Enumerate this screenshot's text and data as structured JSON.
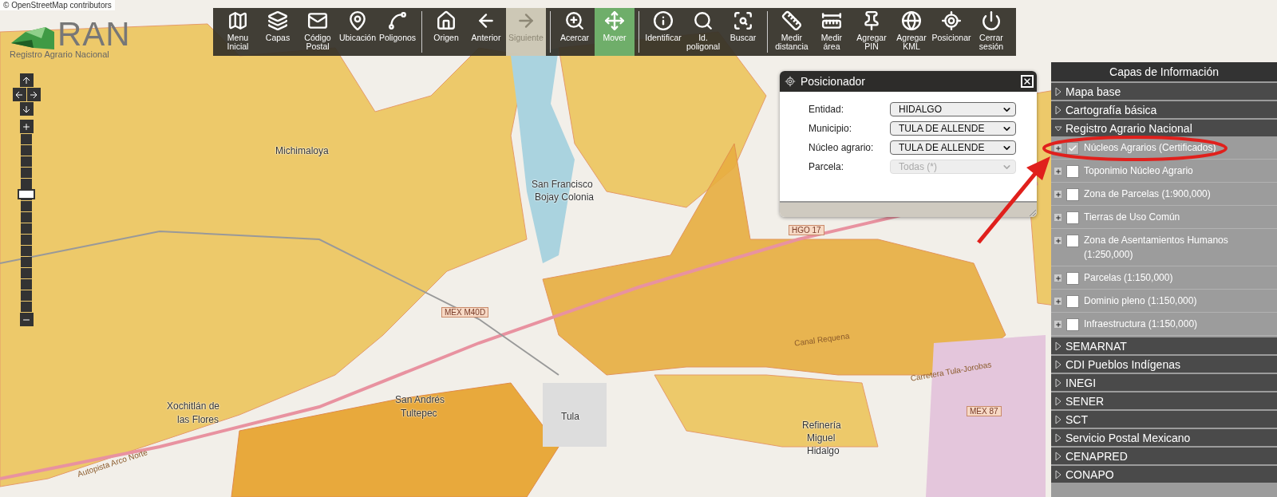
{
  "attribution": "© OpenStreetMap contributors",
  "logo": {
    "name": "RAN",
    "subtitle": "Registro Agrario Nacional"
  },
  "toolbar": [
    [
      {
        "label": "Menu\nInicial",
        "selected": false,
        "disabled": false
      },
      {
        "label": "Capas",
        "selected": false,
        "disabled": false
      },
      {
        "label": "Código\nPostal",
        "selected": false,
        "disabled": false
      },
      {
        "label": "Ubicación",
        "selected": false,
        "disabled": false
      },
      {
        "label": "Poligonos",
        "selected": false,
        "disabled": false
      }
    ],
    [
      {
        "label": "Origen",
        "selected": false,
        "disabled": false
      },
      {
        "label": "Anterior",
        "selected": false,
        "disabled": false
      },
      {
        "label": "Siguiente",
        "selected": false,
        "disabled": true
      }
    ],
    [
      {
        "label": "Acercar",
        "selected": false,
        "disabled": false
      },
      {
        "label": "Mover",
        "selected": true,
        "disabled": false
      }
    ],
    [
      {
        "label": "Identificar",
        "selected": false,
        "disabled": false
      },
      {
        "label": "Id.\npoligonal",
        "selected": false,
        "disabled": false
      },
      {
        "label": "Buscar",
        "selected": false,
        "disabled": false
      }
    ],
    [
      {
        "label": "Medir\ndistancia",
        "selected": false,
        "disabled": false
      },
      {
        "label": "Medir\nárea",
        "selected": false,
        "disabled": false
      },
      {
        "label": "Agregar\nPIN",
        "selected": false,
        "disabled": false
      },
      {
        "label": "Agregar\nKML",
        "selected": false,
        "disabled": false
      },
      {
        "label": "Posicionar",
        "selected": false,
        "disabled": false
      },
      {
        "label": "Cerrar\nsesión",
        "selected": false,
        "disabled": false
      }
    ]
  ],
  "zoom_slider": {
    "level": 0.67
  },
  "map_labels": [
    {
      "text": "Michimaloya",
      "kind": "place"
    },
    {
      "text": "San Francisco",
      "kind": "place"
    },
    {
      "text": "Bojay Colonia",
      "kind": "place"
    },
    {
      "text": "Xochitlán de",
      "kind": "place"
    },
    {
      "text": "las Flores",
      "kind": "place"
    },
    {
      "text": "San Andrés",
      "kind": "place"
    },
    {
      "text": "Tultepec",
      "kind": "place"
    },
    {
      "text": "Tula",
      "kind": "place"
    },
    {
      "text": "Refinería",
      "kind": "place"
    },
    {
      "text": "Miguel",
      "kind": "place"
    },
    {
      "text": "Hidalgo",
      "kind": "place"
    },
    {
      "text": "HGO 17",
      "kind": "shield"
    },
    {
      "text": "MEX M40D",
      "kind": "shield"
    },
    {
      "text": "MEX 87",
      "kind": "shield"
    },
    {
      "text": "Autopista Arco Norte",
      "kind": "road"
    },
    {
      "text": "Carretera Tula-Jorobas",
      "kind": "road"
    },
    {
      "text": "Canal Requena",
      "kind": "road"
    }
  ],
  "dialog": {
    "title": "Posicionador",
    "fields": [
      {
        "label": "Entidad:",
        "value": "HIDALGO",
        "disabled": false
      },
      {
        "label": "Municipio:",
        "value": "TULA DE ALLENDE",
        "disabled": false
      },
      {
        "label": "Núcleo agrario:",
        "value": "TULA DE ALLENDE",
        "disabled": false
      },
      {
        "label": "Parcela:",
        "value": "Todas (*)",
        "disabled": true
      }
    ]
  },
  "layers_panel": {
    "title": "Capas de Información",
    "sections": [
      {
        "label": "Mapa base",
        "expanded": false
      },
      {
        "label": "Cartografía básica",
        "expanded": false
      },
      {
        "label": "Registro Agrario Nacional",
        "expanded": true,
        "children": [
          {
            "label": "Núcleos Agrarios (Certificados)",
            "checked": true
          },
          {
            "label": "Toponimio Núcleo Agrario",
            "checked": false
          },
          {
            "label": "Zona de Parcelas (1:900,000)",
            "checked": false
          },
          {
            "label": "Tierras de Uso Común",
            "checked": false
          },
          {
            "label": "Zona de Asentamientos Humanos (1:250,000)",
            "checked": false
          },
          {
            "label": "Parcelas (1:150,000)",
            "checked": false
          },
          {
            "label": "Dominio pleno (1:150,000)",
            "checked": false
          },
          {
            "label": "Infraestructura (1:150,000)",
            "checked": false
          }
        ]
      },
      {
        "label": "SEMARNAT",
        "expanded": false
      },
      {
        "label": "CDI Pueblos Indígenas",
        "expanded": false
      },
      {
        "label": "INEGI",
        "expanded": false
      },
      {
        "label": "SENER",
        "expanded": false
      },
      {
        "label": "SCT",
        "expanded": false
      },
      {
        "label": "Servicio Postal Mexicano",
        "expanded": false
      },
      {
        "label": "CENAPRED",
        "expanded": false
      },
      {
        "label": "CONAPO",
        "expanded": false
      }
    ]
  }
}
